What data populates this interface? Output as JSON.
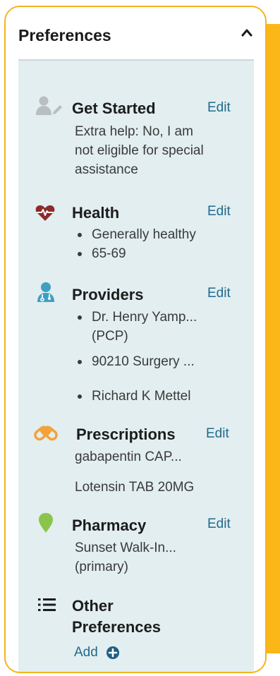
{
  "title": "Preferences",
  "sections": {
    "get_started": {
      "heading": "Get Started",
      "action": "Edit",
      "lines": [
        "Extra help: No, I am",
        "not eligible for special",
        "assistance"
      ]
    },
    "health": {
      "heading": "Health",
      "action": "Edit",
      "bullets": [
        "Generally healthy",
        "65-69"
      ]
    },
    "providers": {
      "heading": "Providers",
      "action": "Edit",
      "bullets": [
        {
          "line1": "Dr. Henry Yamp...",
          "line2": "(PCP)"
        },
        {
          "line1": "90210 Surgery ..."
        },
        {
          "line1": "Richard K Mettel"
        }
      ]
    },
    "prescriptions": {
      "heading": "Prescriptions",
      "action": "Edit",
      "items": [
        "gabapentin CAP...",
        "Lotensin TAB 20MG"
      ]
    },
    "pharmacy": {
      "heading": "Pharmacy",
      "action": "Edit",
      "lines": [
        "Sunset Walk-In...",
        "(primary)"
      ]
    },
    "other": {
      "heading_line1": "Other",
      "heading_line2": "Preferences",
      "action": "Add"
    }
  },
  "colors": {
    "accent": "#f5b31c",
    "panel": "#e2eef0",
    "link": "#226a8d",
    "heart": "#8e2a2a",
    "provider": "#3f9fc2",
    "pills": "#f2a33a",
    "pin": "#8bc44a"
  },
  "icons": {
    "collapse": "chevron-up-icon",
    "get_started": "user-edit-icon",
    "health": "heartbeat-icon",
    "providers": "doctor-icon",
    "prescriptions": "pills-icon",
    "pharmacy": "map-pin-icon",
    "other": "list-icon",
    "add": "plus-circle-icon"
  }
}
